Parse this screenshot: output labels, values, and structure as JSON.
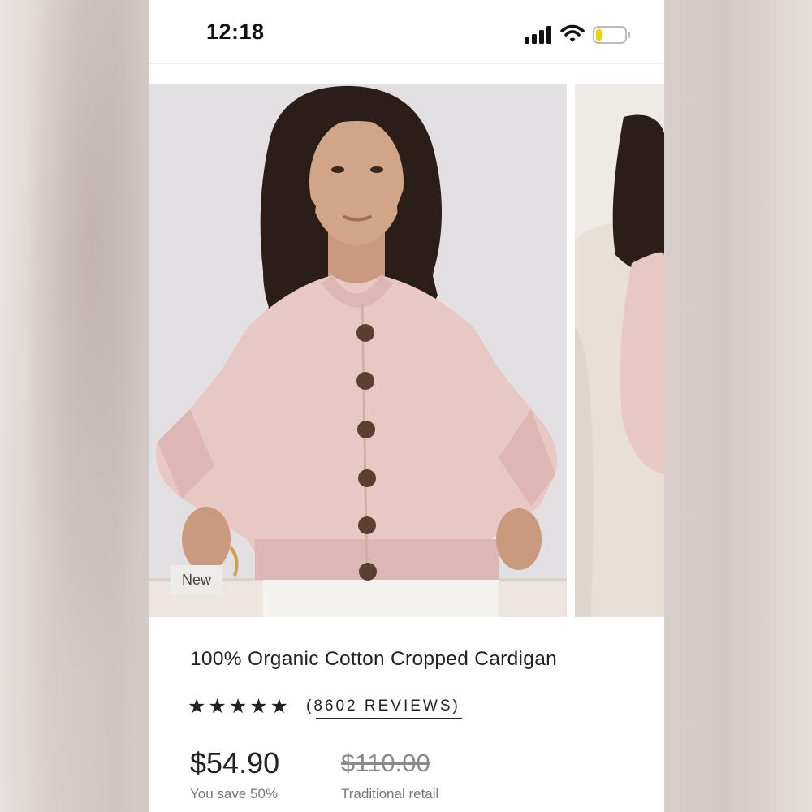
{
  "status_bar": {
    "time": "12:18",
    "icons": [
      "cellular-signal-icon",
      "wifi-icon",
      "battery-low-icon"
    ],
    "battery_level": 0.2,
    "battery_color": "#f5d000"
  },
  "gallery": {
    "photos": [
      {
        "description": "model-wearing-pink-cardigan",
        "badge": "New"
      },
      {
        "description": "model-on-cream-chair"
      }
    ],
    "cardigan_color": "#e8c8c5"
  },
  "product": {
    "title": "100% Organic Cotton Cropped Cardigan",
    "rating": 5,
    "stars": "★★★★★",
    "reviews_label": "(8602 REVIEWS)",
    "sale_price": "$54.90",
    "save_note": "You save 50%",
    "retail_price": "$110.00",
    "retail_note": "Traditional retail"
  }
}
